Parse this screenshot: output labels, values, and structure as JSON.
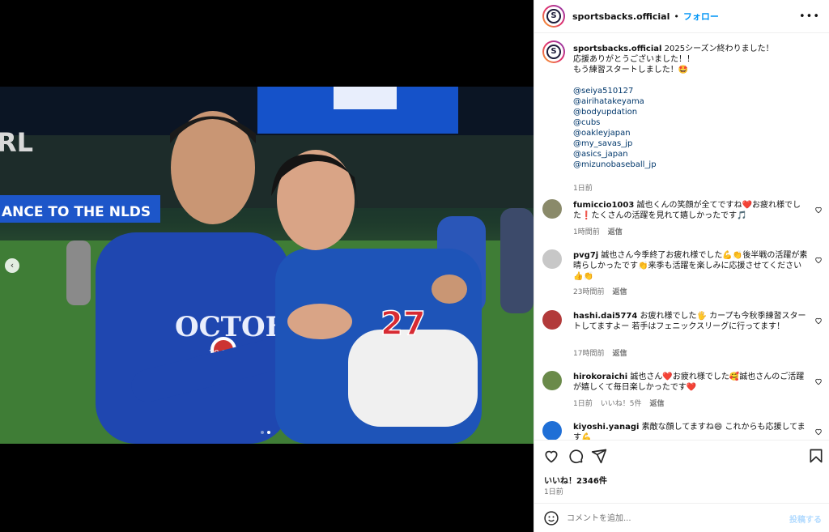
{
  "post": {
    "username": "sportsbacks.official",
    "separator": "•",
    "follow_label": "フォロー",
    "more_label": "•••",
    "avatar_letter": "S"
  },
  "caption": {
    "username": "sportsbacks.official",
    "lines": [
      "2025シーズン終わりました！",
      "応援ありがとうございました！！",
      "もう練習スタートしました！🤩"
    ],
    "tags": [
      "@seiya510127",
      "@airihatakeyama",
      "@bodyupdation",
      "@cubs",
      "@oakleyjapan",
      "@my_savas_jp",
      "@asics_japan",
      "@mizunobaseball_jp"
    ],
    "time": "1日前"
  },
  "comments": [
    {
      "username": "fumiccio1003",
      "text": "誠也くんの笑顔が全てですね❤️お疲れ様でした❗️たくさんの活躍を見れて嬉しかったです🎵",
      "time": "1時間前",
      "reply": "返信",
      "likes": "",
      "avatar_color": "#8a8a6a"
    },
    {
      "username": "pvg7j",
      "text": "誠也さん今季終了お疲れ様でした💪👏後半戦の活躍が素晴らしかったです👏来季も活躍を楽しみに応援させてください👍👏",
      "time": "23時間前",
      "reply": "返信",
      "likes": "",
      "avatar_color": "#c7c7c7"
    },
    {
      "username": "hashi.dai5774",
      "text": "お疲れ様でした🖐 カープも今秋季練習スタートしてますよー 若手はフェニックスリーグに行ってます！",
      "time": "17時間前",
      "reply": "返信",
      "likes": "",
      "avatar_color": "#b23a3a"
    },
    {
      "username": "hirokoraichi",
      "text": "誠也さん❤️お疲れ様でした🥰誠也さんのご活躍が嬉しくて毎日楽しかったです❤️",
      "time": "1日前",
      "reply": "返信",
      "likes": "いいね！5件",
      "avatar_color": "#6a8a4a"
    },
    {
      "username": "kiyoshi.yanagi",
      "text": "素敵な顔してますね😄 これからも応援してます💪",
      "time": "",
      "reply": "",
      "likes": "",
      "avatar_color": "#1f6fd6"
    }
  ],
  "actions": {
    "likes_label": "いいね！2346件",
    "time": "1日前"
  },
  "composer": {
    "placeholder": "コメントを追加...",
    "post_label": "投稿する"
  },
  "media": {
    "prev_label": "‹",
    "slide_count": 2,
    "active_slide": 2,
    "jersey_text": "OCTOBER",
    "jersey_year": "20  25",
    "jersey_number": "27",
    "banner_text": "ANCE TO THE NLDS",
    "sign_text": "RL"
  },
  "colors": {
    "accent": "#0095f6",
    "link": "#00376b",
    "muted": "#737373",
    "heart": "#262626"
  }
}
